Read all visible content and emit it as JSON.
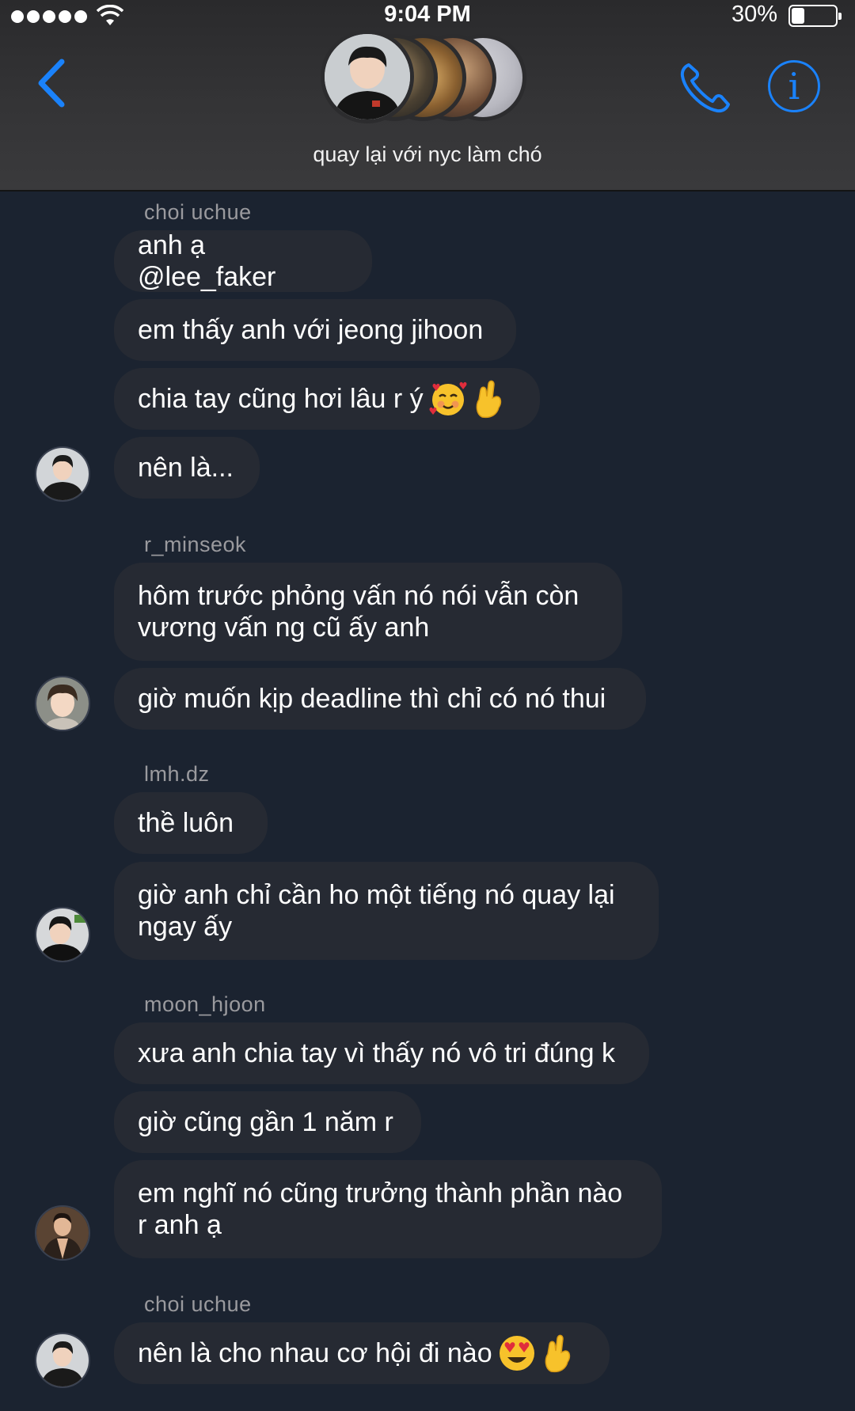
{
  "status_bar": {
    "time": "9:04 PM",
    "battery": "30%",
    "battery_level": 0.3
  },
  "header": {
    "group_name": "quay lại với nyc làm chó"
  },
  "groups": [
    {
      "sender": "choi uchue",
      "messages": [
        "anh ạ @lee_faker",
        "em thấy anh với jeong jihoon",
        "chia tay cũng hơi lâu r ý",
        "nên là..."
      ]
    },
    {
      "sender": "r_minseok",
      "messages": [
        "hôm trước phỏng vấn nó nói vẫn còn\nvương vấn ng cũ ấy anh",
        "giờ muốn kịp deadline thì chỉ có nó thui"
      ]
    },
    {
      "sender": "lmh.dz",
      "messages": [
        "thề luôn",
        "giờ anh chỉ cần ho một tiếng nó quay lại\nngay ấy"
      ]
    },
    {
      "sender": "moon_hjoon",
      "messages": [
        "xưa anh chia tay vì thấy nó vô tri đúng k",
        "giờ cũng gần 1 năm r",
        "em nghĩ nó cũng trưởng thành phần nào\nr anh ạ"
      ]
    },
    {
      "sender": "choi uchue",
      "messages": [
        "nên là cho nhau cơ hội đi nào"
      ]
    }
  ],
  "icons": {
    "back": "chevron-left-icon",
    "call": "phone-icon",
    "info": "info-icon",
    "emoji_smile_hearts": "smiling-face-with-hearts-emoji",
    "emoji_crossed_fingers": "crossed-fingers-emoji",
    "emoji_heart_eyes": "heart-eyes-emoji"
  },
  "colors": {
    "accent": "#1a82fb",
    "background": "#1b2330",
    "bubble": "#262a33",
    "header": "#343436"
  }
}
